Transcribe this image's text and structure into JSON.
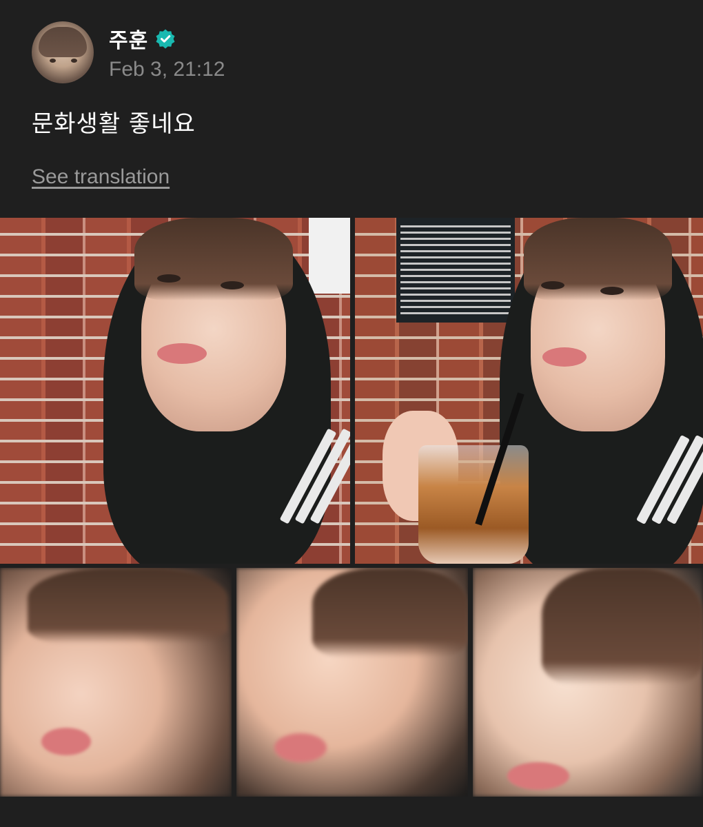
{
  "post": {
    "author": {
      "name": "주훈",
      "verified": true,
      "avatar_icon": "user-avatar"
    },
    "timestamp": "Feb 3, 21:12",
    "text": "문화생활 좋네요",
    "translation_link": "See translation"
  },
  "photos": [
    {
      "description": "hooded selfie in front of brick wall"
    },
    {
      "description": "hooded selfie holding iced drink with peace sign"
    },
    {
      "description": "blurry close-up selfie"
    },
    {
      "description": "blurry close-up selfie"
    },
    {
      "description": "blurry close-up selfie"
    }
  ],
  "colors": {
    "background": "#1f1f1f",
    "verified_badge": "#19b9b0",
    "muted_text": "#8a8a8a"
  }
}
